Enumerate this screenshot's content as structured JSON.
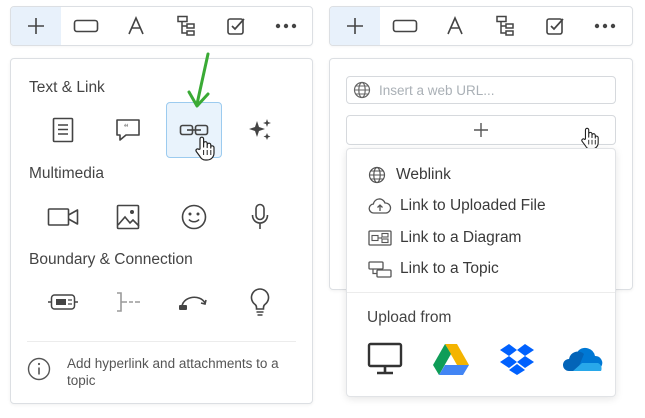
{
  "left_panel": {
    "sections": [
      {
        "title": "Text & Link",
        "items": [
          "note-icon",
          "comment-icon",
          "hyperlink-icon",
          "sparkle-icon"
        ]
      },
      {
        "title": "Multimedia",
        "items": [
          "video-icon",
          "image-icon",
          "smiley-icon",
          "microphone-icon"
        ]
      },
      {
        "title": "Boundary & Connection",
        "items": [
          "boundary-icon",
          "summary-icon",
          "relationship-icon",
          "lightbulb-icon"
        ]
      }
    ],
    "info_text": "Add hyperlink and attachments to a topic"
  },
  "toolbar": {
    "items": [
      "add-icon",
      "topic-icon",
      "text-icon",
      "structure-icon",
      "checkbox-icon",
      "more-icon"
    ]
  },
  "right_panel": {
    "url_placeholder": "Insert a web URL...",
    "menu": {
      "items": [
        "Weblink",
        "Link to Uploaded File",
        "Link to a Diagram",
        "Link to a Topic"
      ],
      "upload_title": "Upload from",
      "upload_sources": [
        "computer-icon",
        "google-drive-icon",
        "dropbox-icon",
        "onedrive-icon"
      ]
    }
  },
  "colors": {
    "accent": "#3a8fd4",
    "active_bg": "#e8f1fb",
    "arrow": "#3aaa35"
  }
}
